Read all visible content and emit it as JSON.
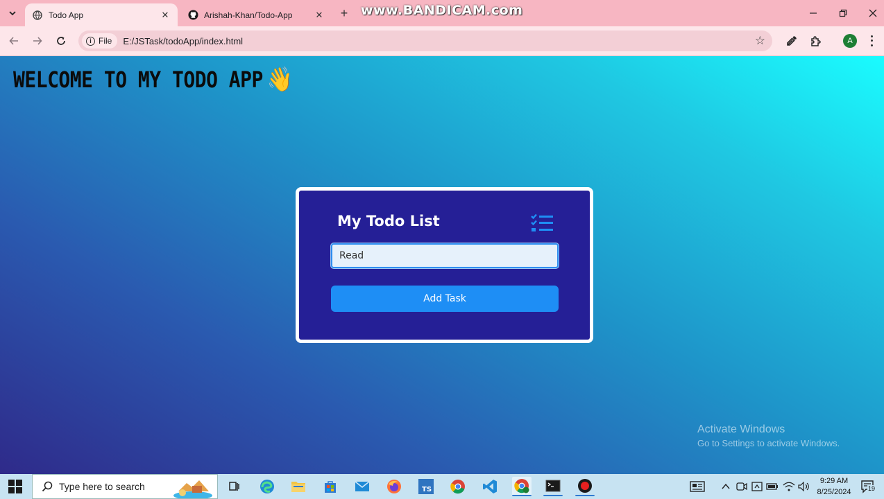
{
  "browser": {
    "tabs": [
      {
        "title": "Todo App",
        "active": true
      },
      {
        "title": "Arishah-Khan/Todo-App",
        "active": false
      }
    ],
    "watermark": "www.BANDICAM.com",
    "address": {
      "chip": "File",
      "url": "E:/JSTask/todoApp/index.html"
    },
    "profile_initial": "A"
  },
  "page": {
    "welcome": "WELCOME TO MY TODO APP",
    "wave_emoji": "👋",
    "card": {
      "title": "My Todo List",
      "input_value": "Read ",
      "add_button": "Add Task"
    }
  },
  "activation": {
    "title": "Activate Windows",
    "subtitle": "Go to Settings to activate Windows."
  },
  "taskbar": {
    "search_placeholder": "Type here to search",
    "time": "9:29 AM",
    "date": "8/25/2024",
    "notification_count": "19"
  },
  "colors": {
    "card_bg": "#251f96",
    "accent_blue": "#1e8ef5",
    "tabstrip": "#f7b6c2"
  }
}
